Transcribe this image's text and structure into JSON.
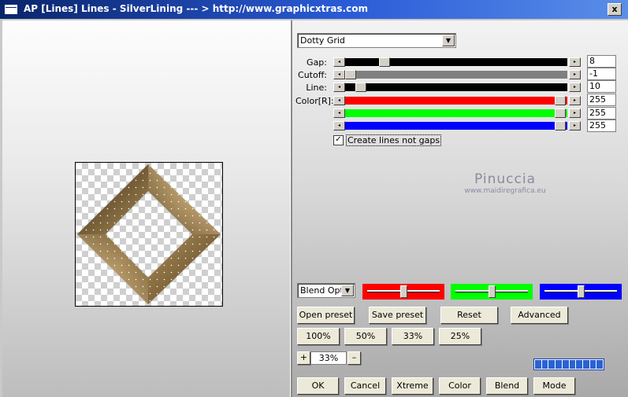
{
  "window": {
    "title": "AP [Lines]  Lines - SilverLining    --- > http://www.graphicxtras.com",
    "close_label": "x"
  },
  "effect": {
    "selected": "Dotty Grid"
  },
  "params": {
    "gap": {
      "label": "Gap:",
      "value": "8",
      "level": 0.17
    },
    "cutoff": {
      "label": "Cutoff:",
      "value": "-1",
      "level": 0.0
    },
    "line": {
      "label": "Line:",
      "value": "10",
      "level": 0.05
    },
    "color_r": {
      "label": "Color[R]:",
      "value": "255",
      "level": 1.0,
      "color": "#ff0000"
    },
    "color_g": {
      "value": "255",
      "level": 1.0,
      "color": "#00ff00"
    },
    "color_b": {
      "value": "255",
      "level": 1.0,
      "color": "#0000ff"
    }
  },
  "create_lines": {
    "label": "Create lines not gaps",
    "checked": true
  },
  "watermark": {
    "line1": "Pinuccia",
    "line2": "www.maidiregrafica.eu"
  },
  "blend": {
    "selected": "Blend Optio"
  },
  "buttons": {
    "open_preset": "Open preset",
    "save_preset": "Save preset",
    "reset": "Reset",
    "advanced": "Advanced",
    "z100": "100%",
    "z50": "50%",
    "z33": "33%",
    "z25": "25%",
    "plus": "+",
    "minus": "–",
    "ok": "OK",
    "cancel": "Cancel",
    "xtreme": "Xtreme",
    "color": "Color",
    "blend": "Blend",
    "mode": "Mode"
  },
  "zoom": {
    "value": "33%"
  },
  "colors": {
    "red": "#ff0000",
    "green": "#00ff00",
    "blue": "#0000ff",
    "shape_dark": "#5a4220",
    "shape_light": "#a88b58"
  }
}
